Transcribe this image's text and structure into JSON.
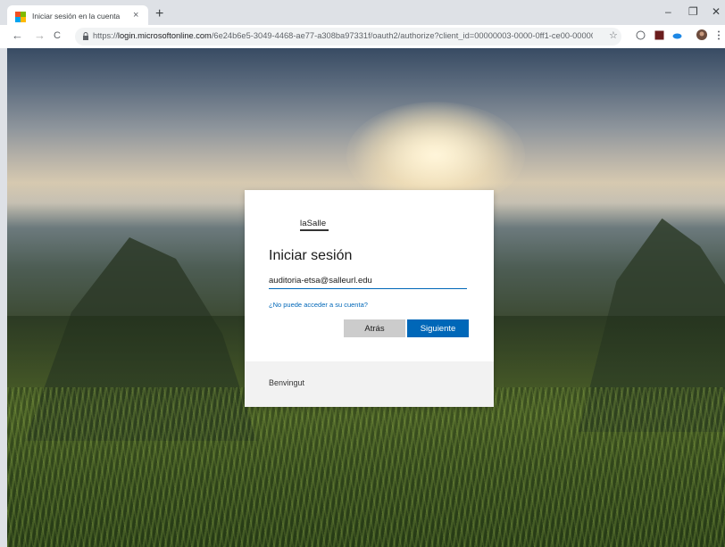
{
  "browser": {
    "tab": {
      "title": "Iniciar sesión en la cuenta",
      "close_glyph": "×",
      "favicon": "microsoft-logo-icon"
    },
    "new_tab_glyph": "+",
    "window_controls": {
      "minimize": "–",
      "restore": "❐",
      "close": "✕"
    },
    "nav": {
      "back": "←",
      "forward": "→",
      "reload": "C"
    },
    "address": {
      "scheme": "https://",
      "host": "login.microsoftonline.com",
      "path": "/6e24b6e5-3049-4468-ae77-a308ba97331f/oauth2/authorize?client_id=00000003-0000-0ff1-ce00-0000000000..."
    },
    "star_glyph": "☆",
    "colors": {
      "ms_red": "#f25022",
      "ms_green": "#7fba00",
      "ms_blue": "#00a4ef",
      "ms_yellow": "#ffb900"
    }
  },
  "signin": {
    "logo_text": "laSalle",
    "heading": "Iniciar sesión",
    "email_value": "auditoria-etsa@salleurl.edu",
    "help_link": "¿No puede acceder a su cuenta?",
    "back_button": "Atrás",
    "next_button": "Siguiente",
    "footer_text": "Benvingut",
    "colors": {
      "primary": "#0067b8",
      "secondary_button": "#cccccc",
      "footer_bg": "#f2f2f2"
    }
  }
}
